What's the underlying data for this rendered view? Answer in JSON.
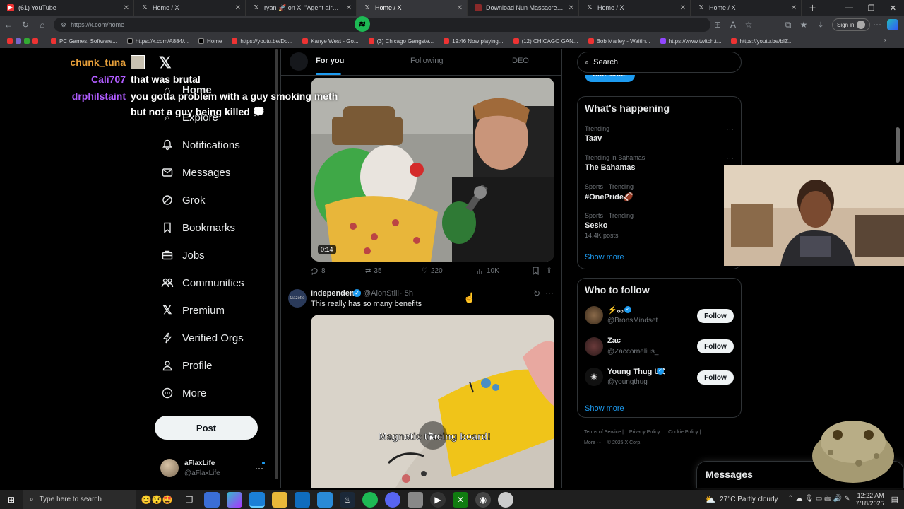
{
  "browser": {
    "tabs": [
      {
        "label": "(61) YouTube",
        "icon": "youtube-icon"
      },
      {
        "label": "Home / X",
        "icon": "x-logo-icon"
      },
      {
        "label": "ryan 🚀 on X: \"Agent airballed o",
        "icon": "x-logo-icon"
      },
      {
        "label": "Home / X",
        "icon": "x-logo-icon"
      },
      {
        "label": "Download Nun Massacre - Full",
        "icon": "app-icon"
      },
      {
        "label": "Home / X",
        "icon": "x-logo-icon"
      },
      {
        "label": "Home / X",
        "icon": "x-logo-icon"
      }
    ],
    "url": "https://x.com/home",
    "signin_label": "Sign in",
    "bookmarks": [
      "PC Games, Software...",
      "https://x.com/A884/...",
      "Home",
      "https://youtu.be/Do...",
      "Kanye West - Go...",
      "(3) Chicago Gangste...",
      "19:46 Now playing...",
      "(12) CHICAGO GAN...",
      "Bob Marley - Waitin...",
      "https://www.twitch.t...",
      "https://youtu.be/bIZ..."
    ]
  },
  "stream_chat": [
    {
      "user": "chunk_tuna",
      "message": "",
      "color": "#e8a03a"
    },
    {
      "user": "Cali707",
      "message": "that was brutal",
      "color": "#b05cff"
    },
    {
      "user": "drphilstaint",
      "message": "you gotta problem with a guy smoking meth",
      "color": "#b05cff"
    },
    {
      "user": "",
      "message": "but not a guy being killed 💭",
      "color": "#ffffff"
    }
  ],
  "nav": {
    "items": [
      {
        "label": "Home",
        "icon": "home-icon"
      },
      {
        "label": "Explore",
        "icon": "search-icon"
      },
      {
        "label": "Notifications",
        "icon": "bell-icon"
      },
      {
        "label": "Messages",
        "icon": "envelope-icon"
      },
      {
        "label": "Grok",
        "icon": "grok-icon"
      },
      {
        "label": "Bookmarks",
        "icon": "bookmark-icon"
      },
      {
        "label": "Jobs",
        "icon": "briefcase-icon"
      },
      {
        "label": "Communities",
        "icon": "people-icon"
      },
      {
        "label": "Premium",
        "icon": "x-logo-icon"
      },
      {
        "label": "Verified Orgs",
        "icon": "lightning-icon"
      },
      {
        "label": "Profile",
        "icon": "person-icon"
      },
      {
        "label": "More",
        "icon": "more-circle-icon"
      }
    ],
    "post_label": "Post",
    "account": {
      "name": "aFlaxLife",
      "handle": "@aFlaxLife"
    }
  },
  "feed": {
    "tabs": [
      "For you",
      "Following",
      "DEO"
    ],
    "post1": {
      "video_duration": "0:14",
      "actions": {
        "replies": "8",
        "reposts": "35",
        "likes": "220",
        "views": "10K"
      }
    },
    "post2": {
      "author": "Independen",
      "handle": "@AlonStill",
      "time": "· 5h",
      "text": "This really has so many benefits",
      "video_caption": "Magnetic tracing board!"
    }
  },
  "sidebar": {
    "search_placeholder": "Search",
    "subscribe_label": "Subscribe",
    "whats_happening_title": "What's happening",
    "trends": [
      {
        "meta": "Trending",
        "name": "Taav",
        "posts": ""
      },
      {
        "meta": "Trending in Bahamas",
        "name": "The Bahamas",
        "posts": ""
      },
      {
        "meta": "Sports · Trending",
        "name": "#OnePride🏈",
        "posts": ""
      },
      {
        "meta": "Sports · Trending",
        "name": "Sesko",
        "posts": "14.4K posts"
      }
    ],
    "show_more": "Show more",
    "who_to_follow_title": "Who to follow",
    "follow_suggestions": [
      {
        "name": "⚡ₒₒ",
        "handle": "@BronsMindset",
        "button": "Follow"
      },
      {
        "name": "Zac",
        "handle": "@Zaccornelius_",
        "button": "Follow"
      },
      {
        "name": "Young Thug ƲՀ",
        "handle": "@youngthug",
        "button": "Follow"
      }
    ],
    "footer_links": [
      "Terms of Service",
      "Privacy Policy",
      "Cookie Policy",
      "More ···",
      "© 2025 X Corp."
    ],
    "messages_label": "Messages"
  },
  "taskbar": {
    "search_placeholder": "Type here to search",
    "weather": "27°C  Partly cloudy",
    "time": "12:22 AM",
    "date": "7/18/2025"
  },
  "colors": {
    "x_blue": "#1d9bf0",
    "chat_orange": "#e8a03a",
    "chat_purple": "#b05cff"
  }
}
